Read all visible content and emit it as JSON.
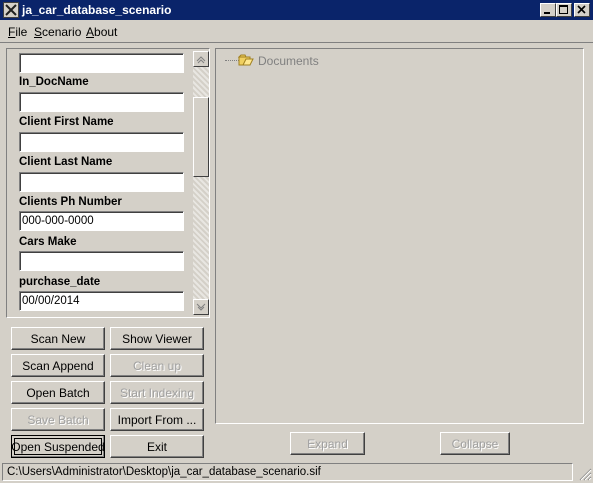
{
  "window": {
    "title": "ja_car_database_scenario"
  },
  "menu": {
    "file": "File",
    "scenario": "Scenario",
    "about": "About"
  },
  "fields": [
    {
      "label": "",
      "value": ""
    },
    {
      "label": "In_DocName",
      "value": ""
    },
    {
      "label": "Client First Name",
      "value": ""
    },
    {
      "label": "Client Last Name",
      "value": ""
    },
    {
      "label": "Clients Ph Number",
      "value": "000-000-0000"
    },
    {
      "label": "Cars Make",
      "value": ""
    },
    {
      "label": "purchase_date",
      "value": "00/00/2014"
    }
  ],
  "buttons": {
    "scan_new": "Scan New",
    "show_viewer": "Show Viewer",
    "scan_append": "Scan Append",
    "clean_up": "Clean up",
    "open_batch": "Open Batch",
    "start_indexing": "Start Indexing",
    "save_batch": "Save Batch",
    "import_from": "Import From ...",
    "open_suspended": "Open Suspended",
    "exit": "Exit"
  },
  "tree": {
    "root_label": "Documents",
    "expand": "Expand",
    "collapse": "Collapse"
  },
  "status": {
    "path": "C:\\Users\\Administrator\\Desktop\\ja_car_database_scenario.sif"
  },
  "colors": {
    "titlebar": "#0a246a",
    "face": "#d4d0c8",
    "disabled_text": "#a0a0a0"
  }
}
